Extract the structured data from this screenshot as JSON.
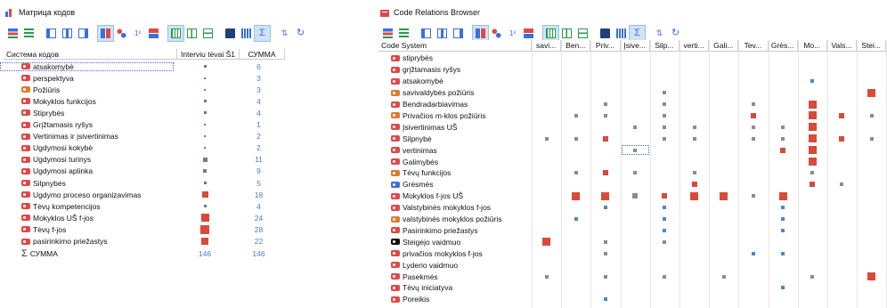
{
  "left": {
    "title": "Матрица кодов",
    "toolbar_icons": [
      "code-system-icon",
      "legend-icon",
      "view-1-icon",
      "view-2-icon",
      "view-3-icon",
      "squares-icon",
      "connect-icon",
      "numbers-icon",
      "values-icon",
      "grid-icon",
      "columns-icon",
      "rows-icon",
      "excel-icon",
      "export-icon",
      "sum-icon",
      "sort-icon",
      "refresh-icon"
    ],
    "headers": {
      "code_system": "Система кодов",
      "col1": "Interviu tėvai Š1",
      "col2": "СУММА"
    },
    "rows": [
      {
        "label": "atsakomybė",
        "color": "#e04848",
        "size": 3,
        "sum": "6"
      },
      {
        "label": "perspektyva",
        "color": "#e04848",
        "size": 2,
        "sum": "3"
      },
      {
        "label": "Požiūris",
        "color": "#e07a30",
        "size": 2,
        "sum": "3"
      },
      {
        "label": "Mokyklos funkcijos",
        "color": "#e04848",
        "size": 3,
        "sum": "4"
      },
      {
        "label": "Stiprybės",
        "color": "#e04848",
        "size": 3,
        "sum": "4"
      },
      {
        "label": "Grįžtamasis ryšys",
        "color": "#e04848",
        "size": 2,
        "sum": "1"
      },
      {
        "label": "Vertinimas ir įsivertinimas",
        "color": "#e04848",
        "size": 2,
        "sum": "2"
      },
      {
        "label": "Ugdymosi kokybė",
        "color": "#e04848",
        "size": 2,
        "sum": "2"
      },
      {
        "label": "Ugdymosi turinys",
        "color": "#e04848",
        "size": 5,
        "sum": "11"
      },
      {
        "label": "Ugdymosi aplinka",
        "color": "#e04848",
        "size": 4,
        "sum": "9"
      },
      {
        "label": "Silpnybės",
        "color": "#e04848",
        "size": 3,
        "sum": "5"
      },
      {
        "label": "Ugdymo proceso organizavimas",
        "color": "#e04848",
        "size": 7,
        "sum": "18"
      },
      {
        "label": "Tėvų kompetencijos",
        "color": "#e04848",
        "size": 3,
        "sum": "4"
      },
      {
        "label": "Mokyklos UŠ f-jos",
        "color": "#e04848",
        "size": 9,
        "sum": "24"
      },
      {
        "label": "Tėvų f-jos",
        "color": "#e04848",
        "size": 10,
        "sum": "28"
      },
      {
        "label": "pasirinkimo priežastys",
        "color": "#e04848",
        "size": 8,
        "sum": "22"
      }
    ],
    "total": {
      "label": "СУММА",
      "col1": "146",
      "col2": "146"
    }
  },
  "right": {
    "title": "Code Relations Browser",
    "toolbar_icons": [
      "code-system-icon",
      "legend-icon",
      "view-1-icon",
      "view-2-icon",
      "view-3-icon",
      "squares-icon",
      "connect-icon",
      "numbers-icon",
      "values-icon",
      "grid-icon",
      "columns-icon",
      "rows-icon",
      "excel-icon",
      "export-icon",
      "sum-icon",
      "sort-icon",
      "refresh-icon"
    ],
    "header_code_system": "Code System",
    "columns": [
      "savi...",
      "Ben...",
      "Priv...",
      "Įsive...",
      "Silp...",
      "verti...",
      "Gali...",
      "Tev...",
      "Grės...",
      "Mo...",
      "Vals...",
      "Stei..."
    ],
    "rows": [
      {
        "label": "stiprybės",
        "color": "#e04848"
      },
      {
        "label": "grįžtamasis ryšys",
        "color": "#e04848"
      },
      {
        "label": "atsakomybė",
        "color": "#e04848"
      },
      {
        "label": "savivaldybės požiūris",
        "color": "#e07a30"
      },
      {
        "label": "Bendradarbiavimas",
        "color": "#e04848"
      },
      {
        "label": "Privačios m-klos požiūris",
        "color": "#e07a30"
      },
      {
        "label": "Įsivertinimas UŠ",
        "color": "#e04848"
      },
      {
        "label": "Silpnybė",
        "color": "#e04848"
      },
      {
        "label": "vertinimas",
        "color": "#e04848"
      },
      {
        "label": "Galimybės",
        "color": "#e04848"
      },
      {
        "label": "Tėvų funkcijos",
        "color": "#e07a30"
      },
      {
        "label": "Grėsmės",
        "color": "#3a6fe0"
      },
      {
        "label": "Mokyklos f-jos UŠ",
        "color": "#e04848"
      },
      {
        "label": "Valstybinės mokyklos f-jos",
        "color": "#e04848"
      },
      {
        "label": "valstybinės mokyklos požiūris",
        "color": "#e07a30"
      },
      {
        "label": "Pasirinkimo priežastys",
        "color": "#e04848"
      },
      {
        "label": "Steigėjo vaidmuo",
        "color": "#111111"
      },
      {
        "label": "privačios mokyklos f-jos",
        "color": "#e04848"
      },
      {
        "label": "Lyderio vaidmuo",
        "color": "#e04848"
      },
      {
        "label": "Pasekmės",
        "color": "#e04848"
      },
      {
        "label": "Tėvų iniciatyva",
        "color": "#e04848"
      },
      {
        "label": "Poreikis",
        "color": "#e04848"
      }
    ],
    "cells": [
      [],
      [],
      [
        [
          9,
          "b",
          2
        ]
      ],
      [
        [
          4,
          "g",
          2
        ],
        [
          11,
          "r",
          4
        ]
      ],
      [
        [
          2,
          "g",
          2
        ],
        [
          4,
          "g",
          2
        ],
        [
          7,
          "g",
          2
        ],
        [
          9,
          "r",
          4
        ]
      ],
      [
        [
          1,
          "g",
          2
        ],
        [
          2,
          "g",
          2
        ],
        [
          4,
          "g",
          2
        ],
        [
          7,
          "r",
          3
        ],
        [
          9,
          "r",
          4
        ],
        [
          10,
          "r",
          3
        ],
        [
          11,
          "g",
          2
        ]
      ],
      [
        [
          3,
          "g",
          2
        ],
        [
          4,
          "g",
          2
        ],
        [
          5,
          "g",
          2
        ],
        [
          7,
          "g",
          2
        ],
        [
          8,
          "g",
          2
        ],
        [
          9,
          "r",
          4
        ]
      ],
      [
        [
          0,
          "g",
          2
        ],
        [
          1,
          "g",
          2
        ],
        [
          2,
          "r",
          3
        ],
        [
          4,
          "g",
          2
        ],
        [
          5,
          "g",
          2
        ],
        [
          7,
          "g",
          2
        ],
        [
          8,
          "g",
          2
        ],
        [
          9,
          "r",
          4
        ],
        [
          10,
          "r",
          3
        ],
        [
          11,
          "g",
          2
        ]
      ],
      [
        [
          3,
          "g",
          2
        ],
        [
          8,
          "r",
          3
        ],
        [
          9,
          "r",
          4
        ]
      ],
      [
        [
          9,
          "r",
          4
        ]
      ],
      [
        [
          1,
          "g",
          2
        ],
        [
          2,
          "r",
          3
        ],
        [
          3,
          "g",
          2
        ],
        [
          5,
          "g",
          2
        ],
        [
          9,
          "g",
          2
        ]
      ],
      [
        [
          5,
          "r",
          3
        ],
        [
          9,
          "r",
          3
        ],
        [
          10,
          "g",
          2
        ]
      ],
      [
        [
          1,
          "r",
          4
        ],
        [
          2,
          "r",
          4
        ],
        [
          3,
          "g",
          3
        ],
        [
          4,
          "r",
          3
        ],
        [
          5,
          "r",
          4
        ],
        [
          6,
          "r",
          4
        ],
        [
          7,
          "g",
          2
        ],
        [
          8,
          "r",
          4
        ]
      ],
      [
        [
          2,
          "b",
          2
        ],
        [
          4,
          "b",
          2
        ],
        [
          8,
          "b",
          2
        ]
      ],
      [
        [
          1,
          "b",
          2
        ],
        [
          4,
          "b",
          2
        ],
        [
          8,
          "b",
          2
        ]
      ],
      [
        [
          4,
          "b",
          2
        ],
        [
          8,
          "b",
          2
        ]
      ],
      [
        [
          0,
          "r",
          4
        ],
        [
          2,
          "g",
          2
        ],
        [
          4,
          "g",
          2
        ]
      ],
      [
        [
          2,
          "g",
          2
        ],
        [
          7,
          "b",
          2
        ],
        [
          8,
          "b",
          2
        ]
      ],
      [],
      [
        [
          0,
          "g",
          2
        ],
        [
          2,
          "g",
          2
        ],
        [
          4,
          "g",
          2
        ],
        [
          6,
          "g",
          2
        ],
        [
          9,
          "g",
          2
        ],
        [
          11,
          "r",
          4
        ]
      ],
      [
        [
          8,
          "b",
          2
        ]
      ],
      [
        [
          2,
          "b",
          2
        ]
      ]
    ]
  }
}
